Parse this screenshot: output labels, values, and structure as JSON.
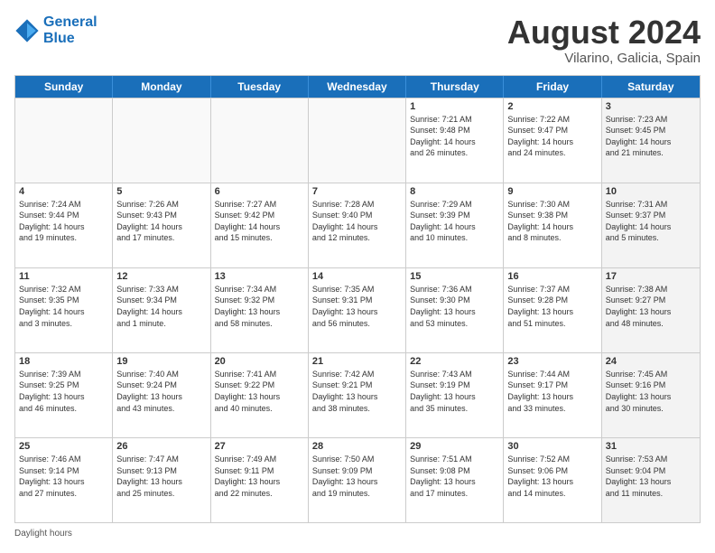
{
  "logo": {
    "line1": "General",
    "line2": "Blue"
  },
  "title": "August 2024",
  "subtitle": "Vilarino, Galicia, Spain",
  "weekdays": [
    "Sunday",
    "Monday",
    "Tuesday",
    "Wednesday",
    "Thursday",
    "Friday",
    "Saturday"
  ],
  "footer": "Daylight hours",
  "weeks": [
    [
      {
        "day": "",
        "info": "",
        "empty": true
      },
      {
        "day": "",
        "info": "",
        "empty": true
      },
      {
        "day": "",
        "info": "",
        "empty": true
      },
      {
        "day": "",
        "info": "",
        "empty": true
      },
      {
        "day": "1",
        "info": "Sunrise: 7:21 AM\nSunset: 9:48 PM\nDaylight: 14 hours\nand 26 minutes."
      },
      {
        "day": "2",
        "info": "Sunrise: 7:22 AM\nSunset: 9:47 PM\nDaylight: 14 hours\nand 24 minutes."
      },
      {
        "day": "3",
        "info": "Sunrise: 7:23 AM\nSunset: 9:45 PM\nDaylight: 14 hours\nand 21 minutes.",
        "shaded": true
      }
    ],
    [
      {
        "day": "4",
        "info": "Sunrise: 7:24 AM\nSunset: 9:44 PM\nDaylight: 14 hours\nand 19 minutes."
      },
      {
        "day": "5",
        "info": "Sunrise: 7:26 AM\nSunset: 9:43 PM\nDaylight: 14 hours\nand 17 minutes."
      },
      {
        "day": "6",
        "info": "Sunrise: 7:27 AM\nSunset: 9:42 PM\nDaylight: 14 hours\nand 15 minutes."
      },
      {
        "day": "7",
        "info": "Sunrise: 7:28 AM\nSunset: 9:40 PM\nDaylight: 14 hours\nand 12 minutes."
      },
      {
        "day": "8",
        "info": "Sunrise: 7:29 AM\nSunset: 9:39 PM\nDaylight: 14 hours\nand 10 minutes."
      },
      {
        "day": "9",
        "info": "Sunrise: 7:30 AM\nSunset: 9:38 PM\nDaylight: 14 hours\nand 8 minutes."
      },
      {
        "day": "10",
        "info": "Sunrise: 7:31 AM\nSunset: 9:37 PM\nDaylight: 14 hours\nand 5 minutes.",
        "shaded": true
      }
    ],
    [
      {
        "day": "11",
        "info": "Sunrise: 7:32 AM\nSunset: 9:35 PM\nDaylight: 14 hours\nand 3 minutes."
      },
      {
        "day": "12",
        "info": "Sunrise: 7:33 AM\nSunset: 9:34 PM\nDaylight: 14 hours\nand 1 minute."
      },
      {
        "day": "13",
        "info": "Sunrise: 7:34 AM\nSunset: 9:32 PM\nDaylight: 13 hours\nand 58 minutes."
      },
      {
        "day": "14",
        "info": "Sunrise: 7:35 AM\nSunset: 9:31 PM\nDaylight: 13 hours\nand 56 minutes."
      },
      {
        "day": "15",
        "info": "Sunrise: 7:36 AM\nSunset: 9:30 PM\nDaylight: 13 hours\nand 53 minutes."
      },
      {
        "day": "16",
        "info": "Sunrise: 7:37 AM\nSunset: 9:28 PM\nDaylight: 13 hours\nand 51 minutes."
      },
      {
        "day": "17",
        "info": "Sunrise: 7:38 AM\nSunset: 9:27 PM\nDaylight: 13 hours\nand 48 minutes.",
        "shaded": true
      }
    ],
    [
      {
        "day": "18",
        "info": "Sunrise: 7:39 AM\nSunset: 9:25 PM\nDaylight: 13 hours\nand 46 minutes."
      },
      {
        "day": "19",
        "info": "Sunrise: 7:40 AM\nSunset: 9:24 PM\nDaylight: 13 hours\nand 43 minutes."
      },
      {
        "day": "20",
        "info": "Sunrise: 7:41 AM\nSunset: 9:22 PM\nDaylight: 13 hours\nand 40 minutes."
      },
      {
        "day": "21",
        "info": "Sunrise: 7:42 AM\nSunset: 9:21 PM\nDaylight: 13 hours\nand 38 minutes."
      },
      {
        "day": "22",
        "info": "Sunrise: 7:43 AM\nSunset: 9:19 PM\nDaylight: 13 hours\nand 35 minutes."
      },
      {
        "day": "23",
        "info": "Sunrise: 7:44 AM\nSunset: 9:17 PM\nDaylight: 13 hours\nand 33 minutes."
      },
      {
        "day": "24",
        "info": "Sunrise: 7:45 AM\nSunset: 9:16 PM\nDaylight: 13 hours\nand 30 minutes.",
        "shaded": true
      }
    ],
    [
      {
        "day": "25",
        "info": "Sunrise: 7:46 AM\nSunset: 9:14 PM\nDaylight: 13 hours\nand 27 minutes."
      },
      {
        "day": "26",
        "info": "Sunrise: 7:47 AM\nSunset: 9:13 PM\nDaylight: 13 hours\nand 25 minutes."
      },
      {
        "day": "27",
        "info": "Sunrise: 7:49 AM\nSunset: 9:11 PM\nDaylight: 13 hours\nand 22 minutes."
      },
      {
        "day": "28",
        "info": "Sunrise: 7:50 AM\nSunset: 9:09 PM\nDaylight: 13 hours\nand 19 minutes."
      },
      {
        "day": "29",
        "info": "Sunrise: 7:51 AM\nSunset: 9:08 PM\nDaylight: 13 hours\nand 17 minutes."
      },
      {
        "day": "30",
        "info": "Sunrise: 7:52 AM\nSunset: 9:06 PM\nDaylight: 13 hours\nand 14 minutes."
      },
      {
        "day": "31",
        "info": "Sunrise: 7:53 AM\nSunset: 9:04 PM\nDaylight: 13 hours\nand 11 minutes.",
        "shaded": true
      }
    ]
  ]
}
